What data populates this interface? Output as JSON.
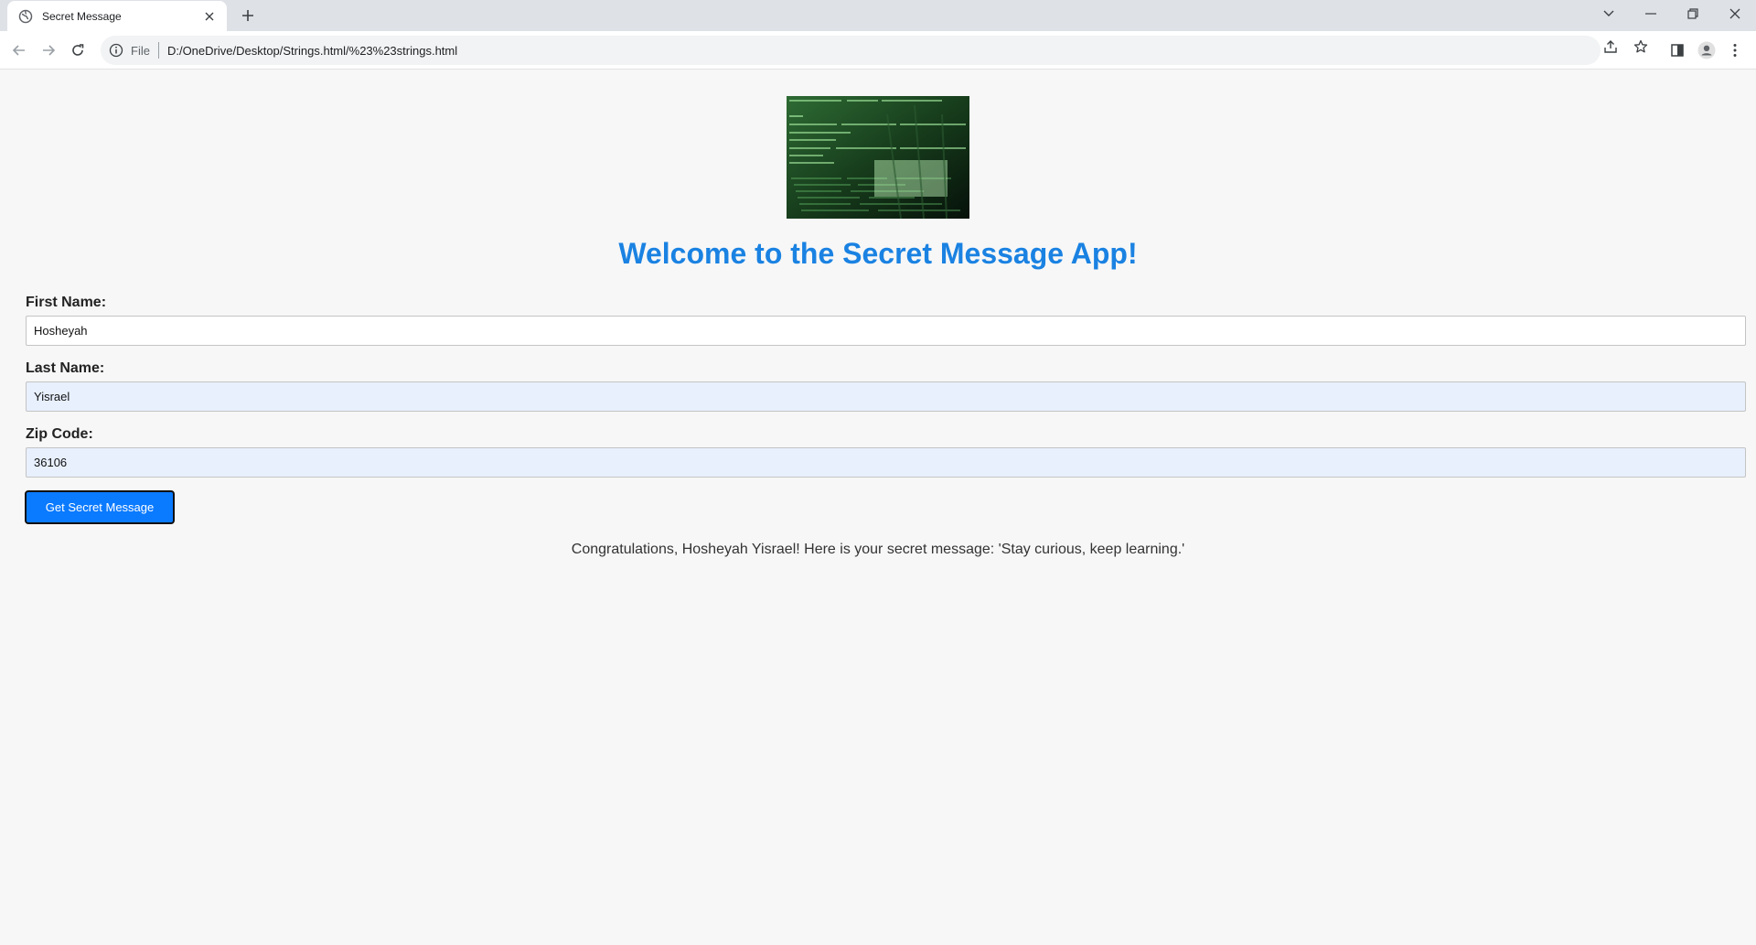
{
  "browser": {
    "tab_title": "Secret Message",
    "address_scheme": "File",
    "address_url": "D:/OneDrive/Desktop/Strings.html/%23%23strings.html"
  },
  "page": {
    "image_alt": "Code screen image",
    "heading": "Welcome to the Secret Message App!",
    "first_name": {
      "label": "First Name:",
      "value": "Hosheyah"
    },
    "last_name": {
      "label": "Last Name:",
      "value": "Yisrael"
    },
    "zip_code": {
      "label": "Zip Code:",
      "value": "36106"
    },
    "button_label": "Get Secret Message",
    "result_message": "Congratulations, Hosheyah Yisrael! Here is your secret message: 'Stay curious, keep learning.'"
  },
  "colors": {
    "heading": "#1a82e2",
    "button": "#0a7aff",
    "autofill": "#e8f0fe"
  }
}
